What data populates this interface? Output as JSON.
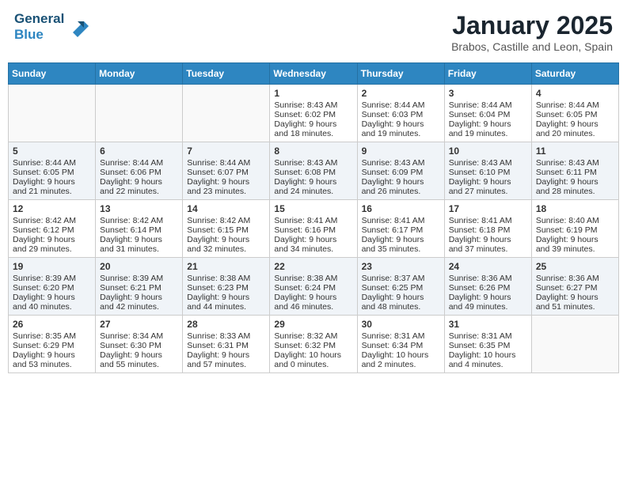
{
  "header": {
    "logo_line1": "General",
    "logo_line2": "Blue",
    "month": "January 2025",
    "location": "Brabos, Castille and Leon, Spain"
  },
  "days_of_week": [
    "Sunday",
    "Monday",
    "Tuesday",
    "Wednesday",
    "Thursday",
    "Friday",
    "Saturday"
  ],
  "weeks": [
    [
      {
        "day": "",
        "sunrise": "",
        "sunset": "",
        "daylight": ""
      },
      {
        "day": "",
        "sunrise": "",
        "sunset": "",
        "daylight": ""
      },
      {
        "day": "",
        "sunrise": "",
        "sunset": "",
        "daylight": ""
      },
      {
        "day": "1",
        "sunrise": "Sunrise: 8:43 AM",
        "sunset": "Sunset: 6:02 PM",
        "daylight": "Daylight: 9 hours and 18 minutes."
      },
      {
        "day": "2",
        "sunrise": "Sunrise: 8:44 AM",
        "sunset": "Sunset: 6:03 PM",
        "daylight": "Daylight: 9 hours and 19 minutes."
      },
      {
        "day": "3",
        "sunrise": "Sunrise: 8:44 AM",
        "sunset": "Sunset: 6:04 PM",
        "daylight": "Daylight: 9 hours and 19 minutes."
      },
      {
        "day": "4",
        "sunrise": "Sunrise: 8:44 AM",
        "sunset": "Sunset: 6:05 PM",
        "daylight": "Daylight: 9 hours and 20 minutes."
      }
    ],
    [
      {
        "day": "5",
        "sunrise": "Sunrise: 8:44 AM",
        "sunset": "Sunset: 6:05 PM",
        "daylight": "Daylight: 9 hours and 21 minutes."
      },
      {
        "day": "6",
        "sunrise": "Sunrise: 8:44 AM",
        "sunset": "Sunset: 6:06 PM",
        "daylight": "Daylight: 9 hours and 22 minutes."
      },
      {
        "day": "7",
        "sunrise": "Sunrise: 8:44 AM",
        "sunset": "Sunset: 6:07 PM",
        "daylight": "Daylight: 9 hours and 23 minutes."
      },
      {
        "day": "8",
        "sunrise": "Sunrise: 8:43 AM",
        "sunset": "Sunset: 6:08 PM",
        "daylight": "Daylight: 9 hours and 24 minutes."
      },
      {
        "day": "9",
        "sunrise": "Sunrise: 8:43 AM",
        "sunset": "Sunset: 6:09 PM",
        "daylight": "Daylight: 9 hours and 26 minutes."
      },
      {
        "day": "10",
        "sunrise": "Sunrise: 8:43 AM",
        "sunset": "Sunset: 6:10 PM",
        "daylight": "Daylight: 9 hours and 27 minutes."
      },
      {
        "day": "11",
        "sunrise": "Sunrise: 8:43 AM",
        "sunset": "Sunset: 6:11 PM",
        "daylight": "Daylight: 9 hours and 28 minutes."
      }
    ],
    [
      {
        "day": "12",
        "sunrise": "Sunrise: 8:42 AM",
        "sunset": "Sunset: 6:12 PM",
        "daylight": "Daylight: 9 hours and 29 minutes."
      },
      {
        "day": "13",
        "sunrise": "Sunrise: 8:42 AM",
        "sunset": "Sunset: 6:14 PM",
        "daylight": "Daylight: 9 hours and 31 minutes."
      },
      {
        "day": "14",
        "sunrise": "Sunrise: 8:42 AM",
        "sunset": "Sunset: 6:15 PM",
        "daylight": "Daylight: 9 hours and 32 minutes."
      },
      {
        "day": "15",
        "sunrise": "Sunrise: 8:41 AM",
        "sunset": "Sunset: 6:16 PM",
        "daylight": "Daylight: 9 hours and 34 minutes."
      },
      {
        "day": "16",
        "sunrise": "Sunrise: 8:41 AM",
        "sunset": "Sunset: 6:17 PM",
        "daylight": "Daylight: 9 hours and 35 minutes."
      },
      {
        "day": "17",
        "sunrise": "Sunrise: 8:41 AM",
        "sunset": "Sunset: 6:18 PM",
        "daylight": "Daylight: 9 hours and 37 minutes."
      },
      {
        "day": "18",
        "sunrise": "Sunrise: 8:40 AM",
        "sunset": "Sunset: 6:19 PM",
        "daylight": "Daylight: 9 hours and 39 minutes."
      }
    ],
    [
      {
        "day": "19",
        "sunrise": "Sunrise: 8:39 AM",
        "sunset": "Sunset: 6:20 PM",
        "daylight": "Daylight: 9 hours and 40 minutes."
      },
      {
        "day": "20",
        "sunrise": "Sunrise: 8:39 AM",
        "sunset": "Sunset: 6:21 PM",
        "daylight": "Daylight: 9 hours and 42 minutes."
      },
      {
        "day": "21",
        "sunrise": "Sunrise: 8:38 AM",
        "sunset": "Sunset: 6:23 PM",
        "daylight": "Daylight: 9 hours and 44 minutes."
      },
      {
        "day": "22",
        "sunrise": "Sunrise: 8:38 AM",
        "sunset": "Sunset: 6:24 PM",
        "daylight": "Daylight: 9 hours and 46 minutes."
      },
      {
        "day": "23",
        "sunrise": "Sunrise: 8:37 AM",
        "sunset": "Sunset: 6:25 PM",
        "daylight": "Daylight: 9 hours and 48 minutes."
      },
      {
        "day": "24",
        "sunrise": "Sunrise: 8:36 AM",
        "sunset": "Sunset: 6:26 PM",
        "daylight": "Daylight: 9 hours and 49 minutes."
      },
      {
        "day": "25",
        "sunrise": "Sunrise: 8:36 AM",
        "sunset": "Sunset: 6:27 PM",
        "daylight": "Daylight: 9 hours and 51 minutes."
      }
    ],
    [
      {
        "day": "26",
        "sunrise": "Sunrise: 8:35 AM",
        "sunset": "Sunset: 6:29 PM",
        "daylight": "Daylight: 9 hours and 53 minutes."
      },
      {
        "day": "27",
        "sunrise": "Sunrise: 8:34 AM",
        "sunset": "Sunset: 6:30 PM",
        "daylight": "Daylight: 9 hours and 55 minutes."
      },
      {
        "day": "28",
        "sunrise": "Sunrise: 8:33 AM",
        "sunset": "Sunset: 6:31 PM",
        "daylight": "Daylight: 9 hours and 57 minutes."
      },
      {
        "day": "29",
        "sunrise": "Sunrise: 8:32 AM",
        "sunset": "Sunset: 6:32 PM",
        "daylight": "Daylight: 10 hours and 0 minutes."
      },
      {
        "day": "30",
        "sunrise": "Sunrise: 8:31 AM",
        "sunset": "Sunset: 6:34 PM",
        "daylight": "Daylight: 10 hours and 2 minutes."
      },
      {
        "day": "31",
        "sunrise": "Sunrise: 8:31 AM",
        "sunset": "Sunset: 6:35 PM",
        "daylight": "Daylight: 10 hours and 4 minutes."
      },
      {
        "day": "",
        "sunrise": "",
        "sunset": "",
        "daylight": ""
      }
    ]
  ]
}
